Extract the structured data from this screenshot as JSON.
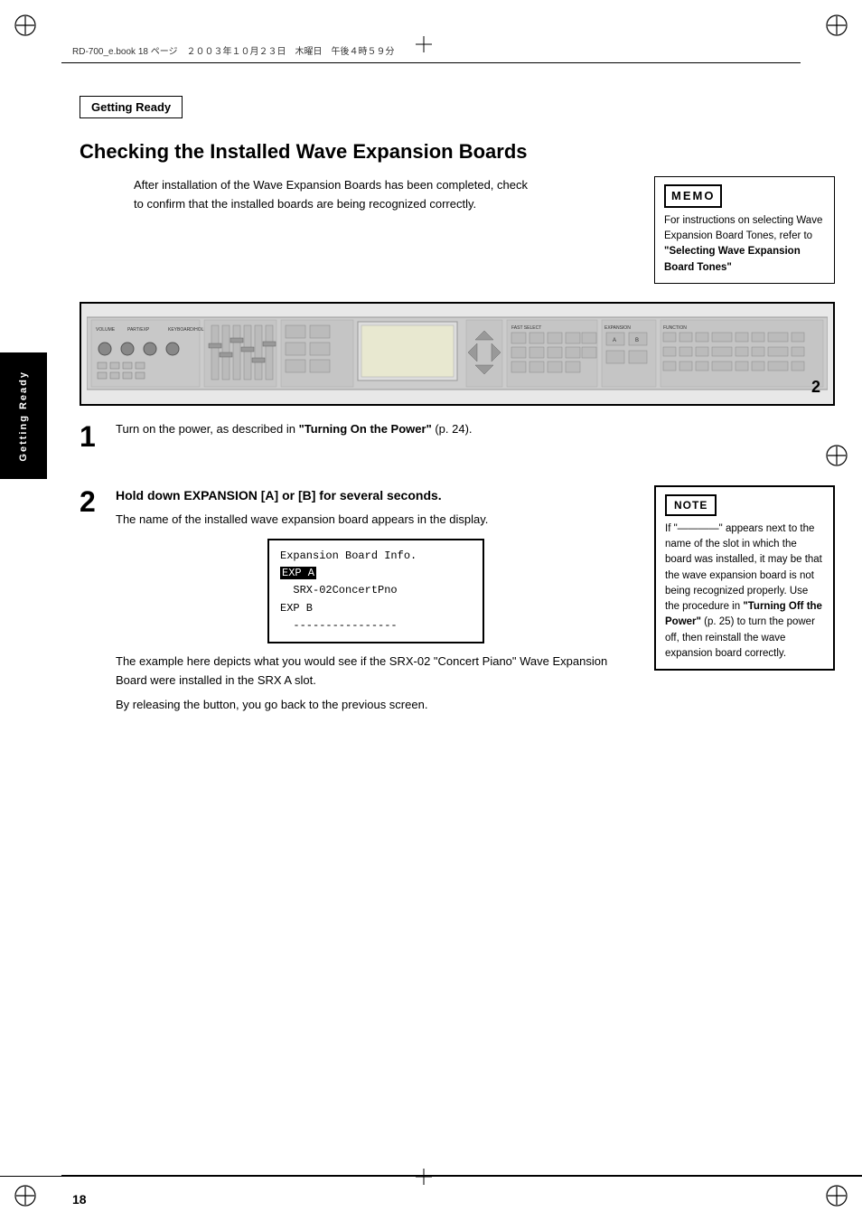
{
  "page": {
    "number": "18",
    "file_info": "RD-700_e.book  18 ページ　２００３年１０月２３日　木曜日　午後４時５９分"
  },
  "sidebar": {
    "label": "Getting Ready"
  },
  "section_title": "Getting Ready",
  "chapter_heading": "Checking the Installed Wave Expansion Boards",
  "intro_text": "After installation of the Wave Expansion Boards has been completed, check\nto confirm that the installed boards are being recognized correctly.",
  "memo": {
    "title": "MEMO",
    "text": "For instructions on selecting Wave Expansion Board Tones, refer to ",
    "bold_text": "\"Selecting Wave Expansion Board Tones\""
  },
  "step1": {
    "number": "1",
    "text": "Turn on the power, as described in ",
    "bold_text": "\"Turning On the Power\"",
    "text2": " (p. 24)."
  },
  "step2": {
    "number": "2",
    "text": "Hold down EXPANSION [A] or [B] for several seconds.",
    "subtext": "The name of the installed wave expansion board appears in the display.",
    "display": {
      "line1": "Expansion Board Info.",
      "line2_highlight": "EXP A",
      "line3": "  SRX-02ConcertPno",
      "line4": "EXP B",
      "line5": "  ----------------"
    },
    "example_text1": "The example here depicts what you would see if the SRX-02 \"Concert Piano\" Wave Expansion Board were installed in the SRX A slot.",
    "example_text2": "By releasing the button, you go back to the previous screen."
  },
  "note": {
    "title": "NOTE",
    "text": "If \"————\" appears next to the name of the slot in which the board was installed, it may be that the wave expansion board is not being recognized properly. Use the procedure in ",
    "bold_text1": "\"Turning Off the Power\"",
    "text2": " (p. 25) to turn the power off, then reinstall the wave expansion board correctly."
  }
}
